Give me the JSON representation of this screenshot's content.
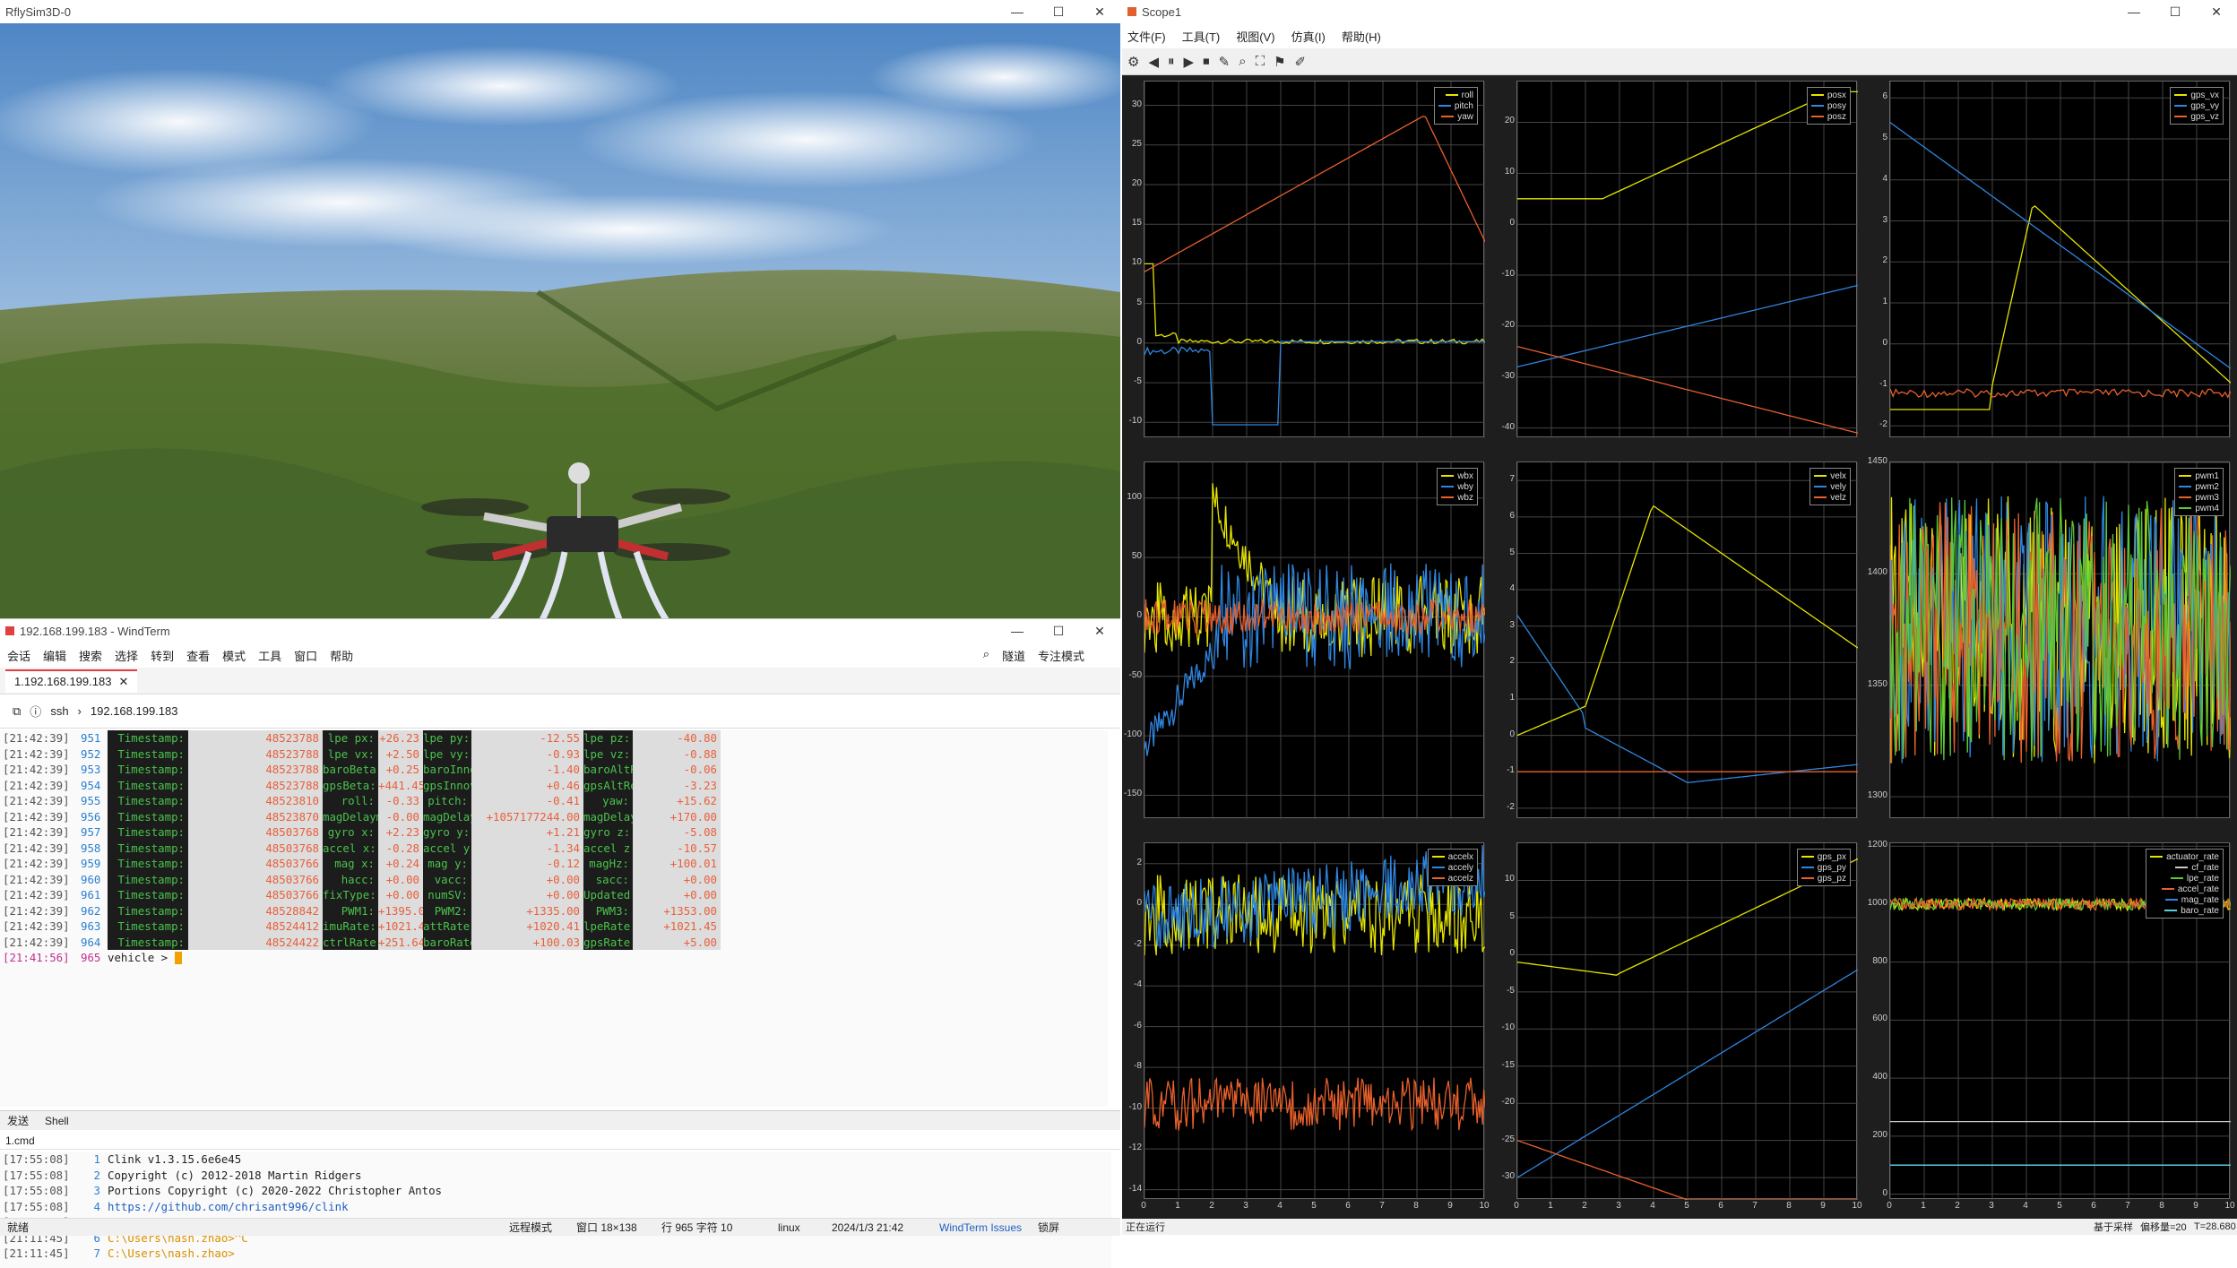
{
  "rflysim": {
    "title": "RflySim3D-0"
  },
  "windterm": {
    "title": "192.168.199.183 - WindTerm",
    "menu": [
      "会话",
      "编辑",
      "搜索",
      "选择",
      "转到",
      "查看",
      "模式",
      "工具",
      "窗口",
      "帮助"
    ],
    "right_menu": [
      "隧道",
      "专注模式"
    ],
    "tab": "1.192.168.199.183",
    "address": {
      "protocol": "ssh",
      "host": "192.168.199.183"
    },
    "rows": [
      {
        "ts": "[21:42:39]",
        "ln": "951",
        "c": [
          [
            "Timestamp:",
            "48523788"
          ],
          [
            "lpe px:",
            "+26.23"
          ],
          [
            "lpe py:",
            "-12.55"
          ],
          [
            "lpe pz:",
            "-40.80"
          ]
        ]
      },
      {
        "ts": "[21:42:39]",
        "ln": "952",
        "c": [
          [
            "Timestamp:",
            "48523788"
          ],
          [
            "lpe vx:",
            "+2.50"
          ],
          [
            "lpe vy:",
            "-0.93"
          ],
          [
            "lpe vz:",
            "-0.88"
          ]
        ]
      },
      {
        "ts": "[21:42:39]",
        "ln": "953",
        "c": [
          [
            "Timestamp:",
            "48523788"
          ],
          [
            "baroBeta:",
            "+0.25"
          ],
          [
            "baroInnov:",
            "-1.40"
          ],
          [
            "baroAltRef:",
            "-0.06"
          ]
        ]
      },
      {
        "ts": "[21:42:39]",
        "ln": "954",
        "c": [
          [
            "Timestamp:",
            "48523788"
          ],
          [
            "gpsBeta:",
            "+441.45"
          ],
          [
            "gpsInnovZ:",
            "+0.46"
          ],
          [
            "gpsAltRef:",
            "-3.23"
          ]
        ]
      },
      {
        "ts": "[21:42:39]",
        "ln": "955",
        "c": [
          [
            "Timestamp:",
            "48523810"
          ],
          [
            "roll:",
            "-0.33"
          ],
          [
            "pitch:",
            "-0.41"
          ],
          [
            "yaw:",
            "+15.62"
          ]
        ]
      },
      {
        "ts": "[21:42:39]",
        "ln": "956",
        "c": [
          [
            "Timestamp:",
            "48523870"
          ],
          [
            "magDelayms:",
            "-0.00"
          ],
          [
            "magDelayIn:",
            "+1057177244.00"
          ],
          [
            "magDelaySt:",
            "+170.00"
          ]
        ]
      },
      {
        "ts": "[21:42:39]",
        "ln": "957",
        "c": [
          [
            "Timestamp:",
            "48503768"
          ],
          [
            "gyro x:",
            "+2.23"
          ],
          [
            "gyro y:",
            "+1.21"
          ],
          [
            "gyro z:",
            "-5.08"
          ]
        ]
      },
      {
        "ts": "[21:42:39]",
        "ln": "958",
        "c": [
          [
            "Timestamp:",
            "48503768"
          ],
          [
            "accel x:",
            "-0.28"
          ],
          [
            "accel y:",
            "-1.34"
          ],
          [
            "accel z:",
            "-10.57"
          ]
        ]
      },
      {
        "ts": "[21:42:39]",
        "ln": "959",
        "c": [
          [
            "Timestamp:",
            "48503766"
          ],
          [
            "mag x:",
            "+0.24"
          ],
          [
            "mag y:",
            "-0.12"
          ],
          [
            "magHz:",
            "+100.01"
          ]
        ]
      },
      {
        "ts": "[21:42:39]",
        "ln": "960",
        "c": [
          [
            "Timestamp:",
            "48503766"
          ],
          [
            "hacc:",
            "+0.00"
          ],
          [
            "vacc:",
            "+0.00"
          ],
          [
            "sacc:",
            "+0.00"
          ]
        ]
      },
      {
        "ts": "[21:42:39]",
        "ln": "961",
        "c": [
          [
            "Timestamp:",
            "48503766"
          ],
          [
            "fixType:",
            "+0.00"
          ],
          [
            "numSV:",
            "+0.00"
          ],
          [
            "Updated:",
            "+0.00"
          ]
        ]
      },
      {
        "ts": "[21:42:39]",
        "ln": "962",
        "c": [
          [
            "Timestamp:",
            "48528842"
          ],
          [
            "PWM1:",
            "+1395.00"
          ],
          [
            "PWM2:",
            "+1335.00"
          ],
          [
            "PWM3:",
            "+1353.00"
          ]
        ]
      },
      {
        "ts": "[21:42:39]",
        "ln": "963",
        "c": [
          [
            "Timestamp:",
            "48524412"
          ],
          [
            "imuRate:",
            "+1021.45"
          ],
          [
            "attRate:",
            "+1020.41"
          ],
          [
            "lpeRate:",
            "+1021.45"
          ]
        ]
      },
      {
        "ts": "[21:42:39]",
        "ln": "964",
        "c": [
          [
            "Timestamp:",
            "48524422"
          ],
          [
            "ctrlRate:",
            "+251.64"
          ],
          [
            "baroRate:",
            "+100.03"
          ],
          [
            "gpsRate:",
            "+5.00"
          ]
        ]
      }
    ],
    "prompt": {
      "ts": "[21:41:56]",
      "ln": "965",
      "text": "vehicle > "
    },
    "pane_tabs": [
      "发送",
      "Shell"
    ],
    "cmd_tab": "1.cmd",
    "cmd_rows": [
      {
        "ts": "[17:55:08]",
        "ln": "1",
        "text": "Clink v1.3.15.6e6e45"
      },
      {
        "ts": "[17:55:08]",
        "ln": "2",
        "text": "Copyright (c) 2012-2018 Martin Ridgers"
      },
      {
        "ts": "[17:55:08]",
        "ln": "3",
        "text": "Portions Copyright (c) 2020-2022 Christopher Antos"
      },
      {
        "ts": "[17:55:08]",
        "ln": "4",
        "text": "https://github.com/chrisant996/clink"
      },
      {
        "ts": "[17:55:08]",
        "ln": "5",
        "text": ""
      },
      {
        "ts": "[21:11:45]",
        "ln": "6",
        "text": "C:\\Users\\nash.zhao>^C"
      },
      {
        "ts": "[21:11:45]",
        "ln": "7",
        "text": "C:\\Users\\nash.zhao>"
      }
    ],
    "statusbar": {
      "ready": "就绪",
      "mode": "远程模式",
      "window": "窗口 18×138",
      "pos": "行 965 字符 10",
      "os": "linux",
      "datetime": "2024/1/3 21:42",
      "issues": "WindTerm Issues",
      "lock": "锁屏"
    }
  },
  "scope": {
    "title": "Scope1",
    "menu": [
      "文件(F)",
      "工具(T)",
      "视图(V)",
      "仿真(I)",
      "帮助(H)"
    ],
    "status": {
      "left": "正在运行",
      "r1": "基于采样",
      "r2": "偏移量=20",
      "r3": "T=28.680"
    },
    "colors": {
      "s1": "#e5e500",
      "s2": "#2f86e0",
      "s3": "#e8602c",
      "s4": "#5ac836",
      "s5": "#c8c8c8",
      "s6": "#5ad0e0"
    },
    "x_ticks": [
      "0",
      "1",
      "2",
      "3",
      "4",
      "5",
      "6",
      "7",
      "8",
      "9",
      "10"
    ],
    "plots": [
      {
        "legend": [
          "roll",
          "pitch",
          "yaw"
        ],
        "yticks": [
          "30",
          "25",
          "20",
          "15",
          "10",
          "5",
          "0",
          "-5",
          "-10"
        ],
        "ylim": [
          -12,
          33
        ]
      },
      {
        "legend": [
          "posx",
          "posy",
          "posz"
        ],
        "yticks": [
          "20",
          "10",
          "0",
          "-10",
          "-20",
          "-30",
          "-40"
        ],
        "ylim": [
          -42,
          28
        ]
      },
      {
        "legend": [
          "gps_vx",
          "gps_vy",
          "gps_vz"
        ],
        "yticks": [
          "6",
          "5",
          "4",
          "3",
          "2",
          "1",
          "0",
          "-1",
          "-2"
        ],
        "ylim": [
          -2.3,
          6.4
        ]
      },
      {
        "legend": [
          "wbx",
          "wby",
          "wbz"
        ],
        "yticks": [
          "100",
          "50",
          "0",
          "-50",
          "-100",
          "-150"
        ],
        "ylim": [
          -170,
          130
        ]
      },
      {
        "legend": [
          "velx",
          "vely",
          "velz"
        ],
        "yticks": [
          "7",
          "6",
          "5",
          "4",
          "3",
          "2",
          "1",
          "0",
          "-1",
          "-2"
        ],
        "ylim": [
          -2.3,
          7.5
        ]
      },
      {
        "legend": [
          "pwm1",
          "pwm2",
          "pwm3",
          "pwm4"
        ],
        "yticks": [
          "1450",
          "1400",
          "1350",
          "1300"
        ],
        "ylim": [
          1290,
          1450
        ]
      },
      {
        "legend": [
          "accelx",
          "accely",
          "accelz"
        ],
        "yticks": [
          "2",
          "0",
          "-2",
          "-4",
          "-6",
          "-8",
          "-10",
          "-12",
          "-14"
        ],
        "ylim": [
          -14.5,
          3
        ]
      },
      {
        "legend": [
          "gps_px",
          "gps_py",
          "gps_pz"
        ],
        "yticks": [
          "10",
          "5",
          "0",
          "-5",
          "-10",
          "-15",
          "-20",
          "-25",
          "-30"
        ],
        "ylim": [
          -33,
          15
        ]
      },
      {
        "legend": [
          "actuator_rate",
          "cf_rate",
          "lpe_rate",
          "accel_rate",
          "mag_rate",
          "baro_rate"
        ],
        "yticks": [
          "1200",
          "1000",
          "800",
          "600",
          "400",
          "200",
          "0"
        ],
        "ylim": [
          -20,
          1210
        ]
      }
    ]
  }
}
